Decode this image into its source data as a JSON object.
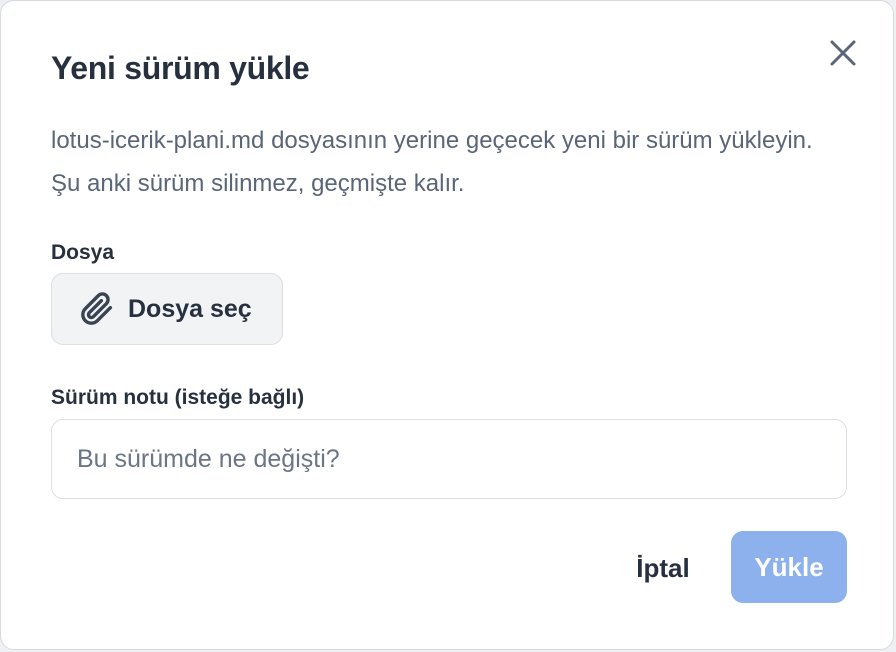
{
  "dialog": {
    "title": "Yeni sürüm yükle",
    "description": "lotus-icerik-plani.md dosyasının yerine geçecek yeni bir sürüm yükleyin. Şu anki sürüm silinmez, geçmişte kalır.",
    "close_icon": "close-icon"
  },
  "file_field": {
    "label": "Dosya",
    "button_label": "Dosya seç",
    "button_icon": "paperclip-icon"
  },
  "note_field": {
    "label": "Sürüm notu (isteğe bağlı)",
    "value": "",
    "placeholder": "Bu sürümde ne değişti?"
  },
  "actions": {
    "cancel_label": "İptal",
    "upload_label": "Yükle",
    "upload_disabled": true,
    "upload_color": "#8cb1ec"
  }
}
